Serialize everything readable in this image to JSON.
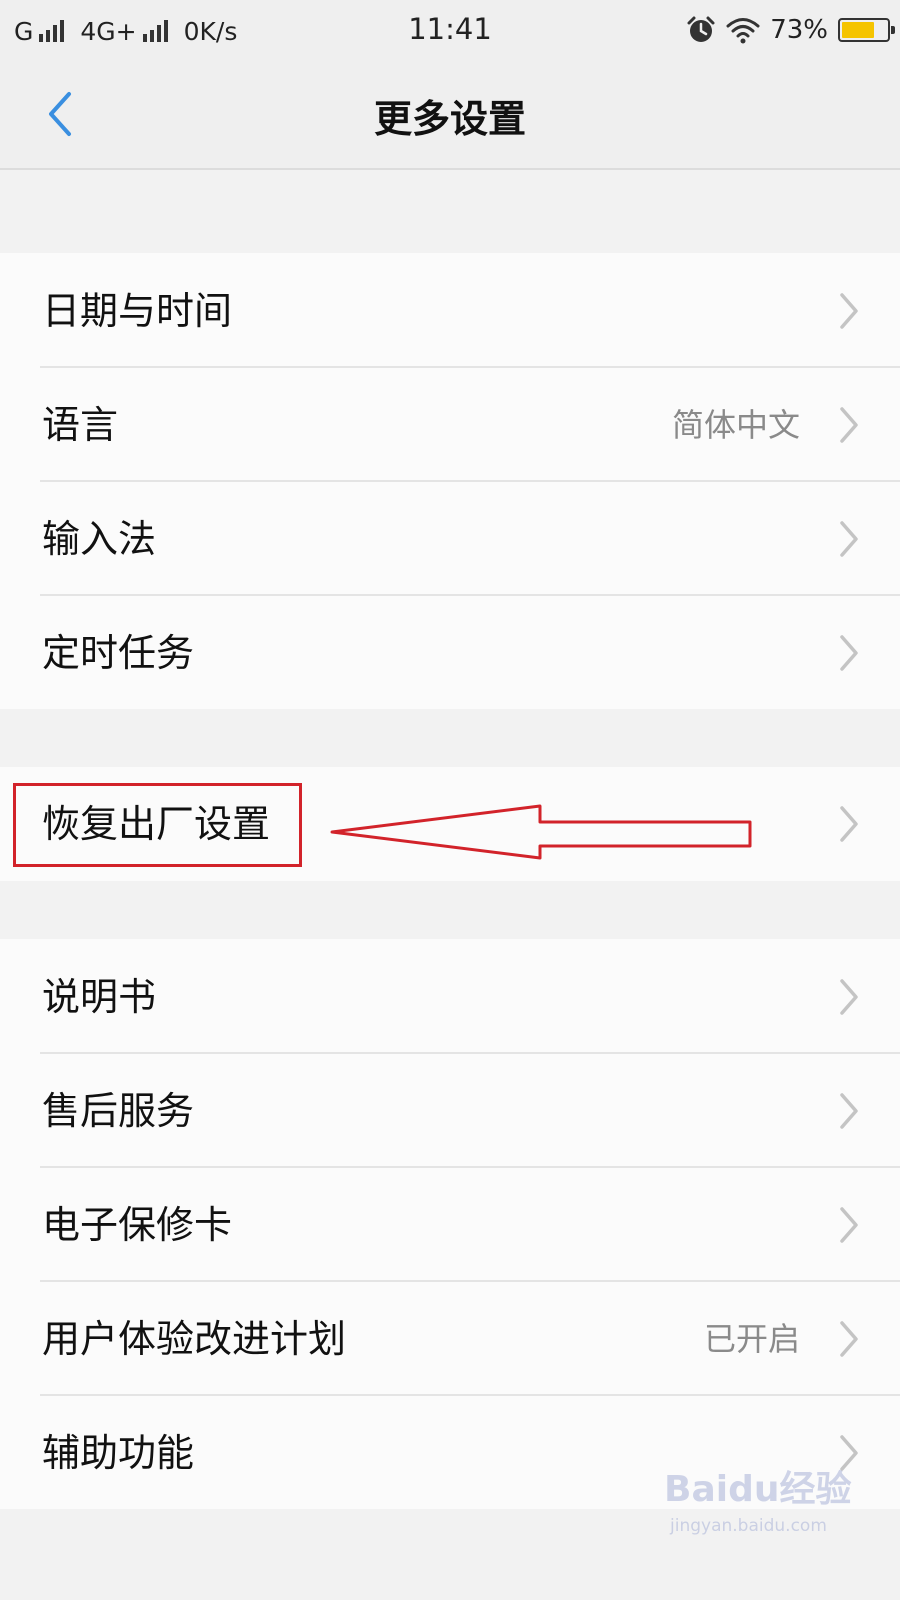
{
  "status_bar": {
    "network1": "G",
    "network2": "4G+",
    "speed": "0K/s",
    "time": "11:41",
    "battery_percent": "73%",
    "battery_level": 0.73,
    "battery_color": "#f5c400"
  },
  "nav": {
    "title": "更多设置",
    "back_icon": "chevron-left-icon",
    "accent": "#3a8fe0"
  },
  "groups": [
    {
      "items": [
        {
          "label": "日期与时间",
          "value": ""
        },
        {
          "label": "语言",
          "value": "简体中文"
        },
        {
          "label": "输入法",
          "value": ""
        },
        {
          "label": "定时任务",
          "value": ""
        }
      ]
    },
    {
      "items": [
        {
          "label": "恢复出厂设置",
          "value": ""
        }
      ]
    },
    {
      "items": [
        {
          "label": "说明书",
          "value": ""
        },
        {
          "label": "售后服务",
          "value": ""
        },
        {
          "label": "电子保修卡",
          "value": ""
        },
        {
          "label": "用户体验改进计划",
          "value": "已开启"
        },
        {
          "label": "辅助功能",
          "value": ""
        }
      ]
    }
  ],
  "annotation": {
    "color": "#d2232a"
  },
  "watermark": {
    "logo": "Baidu经验",
    "url": "jingyan.baidu.com"
  }
}
